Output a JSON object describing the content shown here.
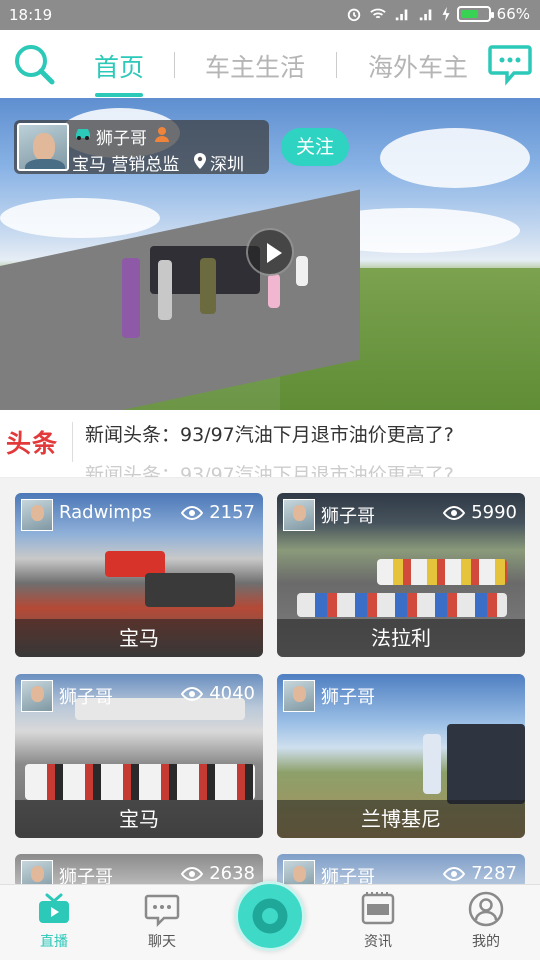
{
  "status_bar": {
    "time": "18:19",
    "battery": "66%",
    "battery_level": 0.66
  },
  "top_nav": {
    "tabs": [
      {
        "label": "首页",
        "active": true
      },
      {
        "label": "车主生活",
        "active": false
      },
      {
        "label": "海外车主",
        "active": false
      }
    ],
    "search_icon": "search-icon",
    "message_icon": "chat-bubble-icon"
  },
  "hero": {
    "user_name": "狮子哥",
    "car_brand": "宝马",
    "role": "营销总监",
    "city": "深圳",
    "follow_label": "关注",
    "play_icon": "play-icon"
  },
  "news": {
    "logo": "头条",
    "headline": "新闻头条：93/97汽油下月退市油价更高了?",
    "headline_next": "新闻头条：93/97汽油下月退市油价更高了?"
  },
  "cards": [
    {
      "user": "Radwimps",
      "views": "2157",
      "caption": "宝马"
    },
    {
      "user": "狮子哥",
      "views": "5990",
      "caption": "法拉利"
    },
    {
      "user": "狮子哥",
      "views": "4040",
      "caption": "宝马"
    },
    {
      "user": "狮子哥",
      "views": "",
      "caption": "兰博基尼"
    },
    {
      "user": "狮子哥",
      "views": "2638",
      "caption": ""
    },
    {
      "user": "狮子哥",
      "views": "7287",
      "caption": ""
    }
  ],
  "bottom_nav": [
    {
      "label": "直播",
      "icon": "tv-icon",
      "active": true
    },
    {
      "label": "聊天",
      "icon": "chat-icon",
      "active": false
    },
    {
      "label": "",
      "icon": "record-icon",
      "active": false
    },
    {
      "label": "资讯",
      "icon": "news-icon",
      "active": false
    },
    {
      "label": "我的",
      "icon": "profile-icon",
      "active": false
    }
  ],
  "colors": {
    "accent": "#2cc9b9",
    "news_red": "#e23a3a"
  }
}
